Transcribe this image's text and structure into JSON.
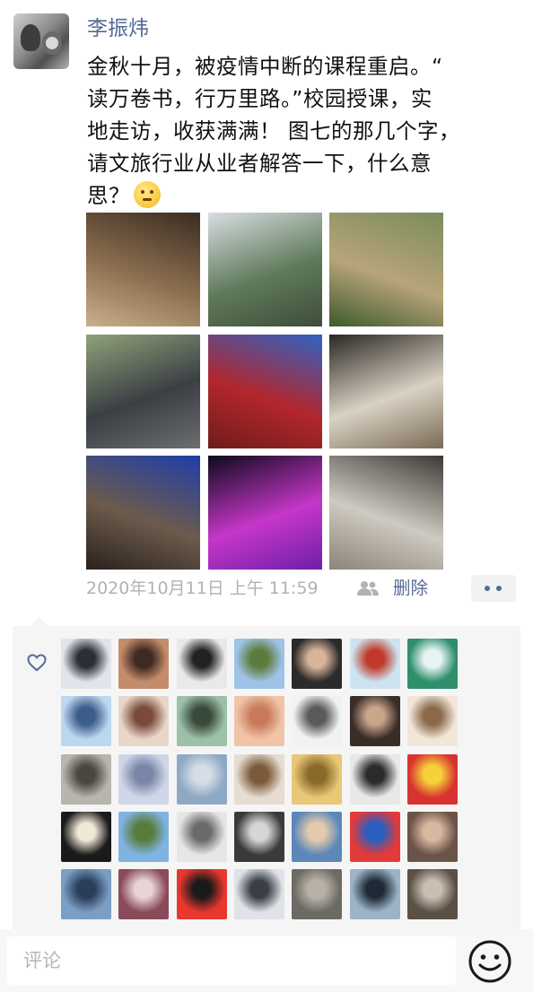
{
  "post": {
    "username": "李振炜",
    "text_lines": [
      "金秋十月，被疫情中断的课程重启。“",
      "读万卷书，行万里路。”校园授课，实",
      "地走访，收获满满！ 图七的那几个字，",
      "请文旅行业从业者解答一下，什么意",
      "思？"
    ],
    "emoji_icon": "thinking-face-icon",
    "timestamp": "2020年10月11日 上午 11:59",
    "visibility_icon": "people-icon",
    "delete_label": "删除",
    "more_icon": "more-dots-icon"
  },
  "photos": [
    {
      "name": "photo-study-room",
      "colors": [
        "#3a2c22",
        "#8b6e4f",
        "#c9b08a"
      ]
    },
    {
      "name": "photo-mountain-village",
      "colors": [
        "#d8dde2",
        "#5f7a5a",
        "#3f4d3a"
      ]
    },
    {
      "name": "photo-planting-tree",
      "colors": [
        "#7a8c5a",
        "#b8a47a",
        "#3d5a2c"
      ]
    },
    {
      "name": "photo-group-courtyard",
      "colors": [
        "#8fa27a",
        "#3b3f44",
        "#6a6e70"
      ]
    },
    {
      "name": "photo-red-pavilion",
      "colors": [
        "#2f63c4",
        "#b3262c",
        "#6e1d1a"
      ]
    },
    {
      "name": "photo-meeting-table",
      "colors": [
        "#2a2621",
        "#d9d2c4",
        "#7a6a55"
      ]
    },
    {
      "name": "photo-old-gate",
      "colors": [
        "#1e3ea8",
        "#6c5b4c",
        "#2a211c"
      ]
    },
    {
      "name": "photo-night-stage",
      "colors": [
        "#0c0a1a",
        "#c636c9",
        "#6d1fa8"
      ]
    },
    {
      "name": "photo-stone-screen",
      "colors": [
        "#3d3a36",
        "#cfcac1",
        "#8a847a"
      ]
    }
  ],
  "likes": {
    "heart_icon": "heart-outline-icon",
    "avatars": [
      [
        "#dfe5ea",
        "#2a2f36"
      ],
      [
        "#c58c6a",
        "#3d2a22"
      ],
      [
        "#e9e9e9",
        "#222222"
      ],
      [
        "#9ec3e6",
        "#5d7b3a"
      ],
      [
        "#2b2b2b",
        "#d8b49a"
      ],
      [
        "#cde3f0",
        "#c0392b"
      ],
      [
        "#2f8f6b",
        "#e8f3f6"
      ],
      [
        "#bcd7ef",
        "#3c5c8a"
      ],
      [
        "#e8d6c9",
        "#7a4a3a"
      ],
      [
        "#9cc0a8",
        "#3a4a3a"
      ],
      [
        "#f1c4a8",
        "#c77a5a"
      ],
      [
        "#f2f2f2",
        "#5a5a5a"
      ],
      [
        "#3a2d28",
        "#c9a58c"
      ],
      [
        "#f2e6da",
        "#8a6a4a"
      ],
      [
        "#b8b4ae",
        "#4a4640"
      ],
      [
        "#cfd6e8",
        "#7a86a8"
      ],
      [
        "#8ea9c4",
        "#d5dde6"
      ],
      [
        "#e6dccf",
        "#7a5a3a"
      ],
      [
        "#e9c776",
        "#8a6a2a"
      ],
      [
        "#e8e8e8",
        "#2b2b2b"
      ],
      [
        "#d8342f",
        "#f5d23a"
      ],
      [
        "#1a1a1a",
        "#f2e8d8"
      ],
      [
        "#7fb3e0",
        "#5a7a3a"
      ],
      [
        "#e6e6e6",
        "#6a6a6a"
      ],
      [
        "#3a3a3a",
        "#d6d6d6"
      ],
      [
        "#5c87b8",
        "#e3c9ad"
      ],
      [
        "#e23a3a",
        "#2a5fc0"
      ],
      [
        "#6a5448",
        "#d8b8a0"
      ],
      [
        "#7a9ec4",
        "#2a3d5a"
      ],
      [
        "#8a4a5a",
        "#e8d4d8"
      ],
      [
        "#e8382e",
        "#1a1a1a"
      ],
      [
        "#dfe3e8",
        "#3a3f46"
      ],
      [
        "#6c6a64",
        "#b8b2a6"
      ],
      [
        "#9db4c8",
        "#1f2a36"
      ],
      [
        "#5a5045",
        "#c9bfb3"
      ]
    ],
    "avatar_names": [
      "liker-avatar-1",
      "liker-avatar-2",
      "liker-avatar-3",
      "liker-avatar-4",
      "liker-avatar-5",
      "liker-avatar-6",
      "liker-avatar-7",
      "liker-avatar-8",
      "liker-avatar-9",
      "liker-avatar-10",
      "liker-avatar-11",
      "liker-avatar-12",
      "liker-avatar-13",
      "liker-avatar-14",
      "liker-avatar-15",
      "liker-avatar-16",
      "liker-avatar-17",
      "liker-avatar-18",
      "liker-avatar-19",
      "liker-avatar-20",
      "liker-avatar-21",
      "liker-avatar-22",
      "liker-avatar-23",
      "liker-avatar-24",
      "liker-avatar-25",
      "liker-avatar-26",
      "liker-avatar-27",
      "liker-avatar-28",
      "liker-avatar-29",
      "liker-avatar-30",
      "liker-avatar-31",
      "liker-avatar-32",
      "liker-avatar-33",
      "liker-avatar-34",
      "liker-avatar-35"
    ]
  },
  "comment": {
    "placeholder": "评论",
    "emoji_button_icon": "smiley-face-icon"
  },
  "colors": {
    "link": "#576b95",
    "muted": "#b2b2b2",
    "panel_bg": "#f5f5f5"
  }
}
